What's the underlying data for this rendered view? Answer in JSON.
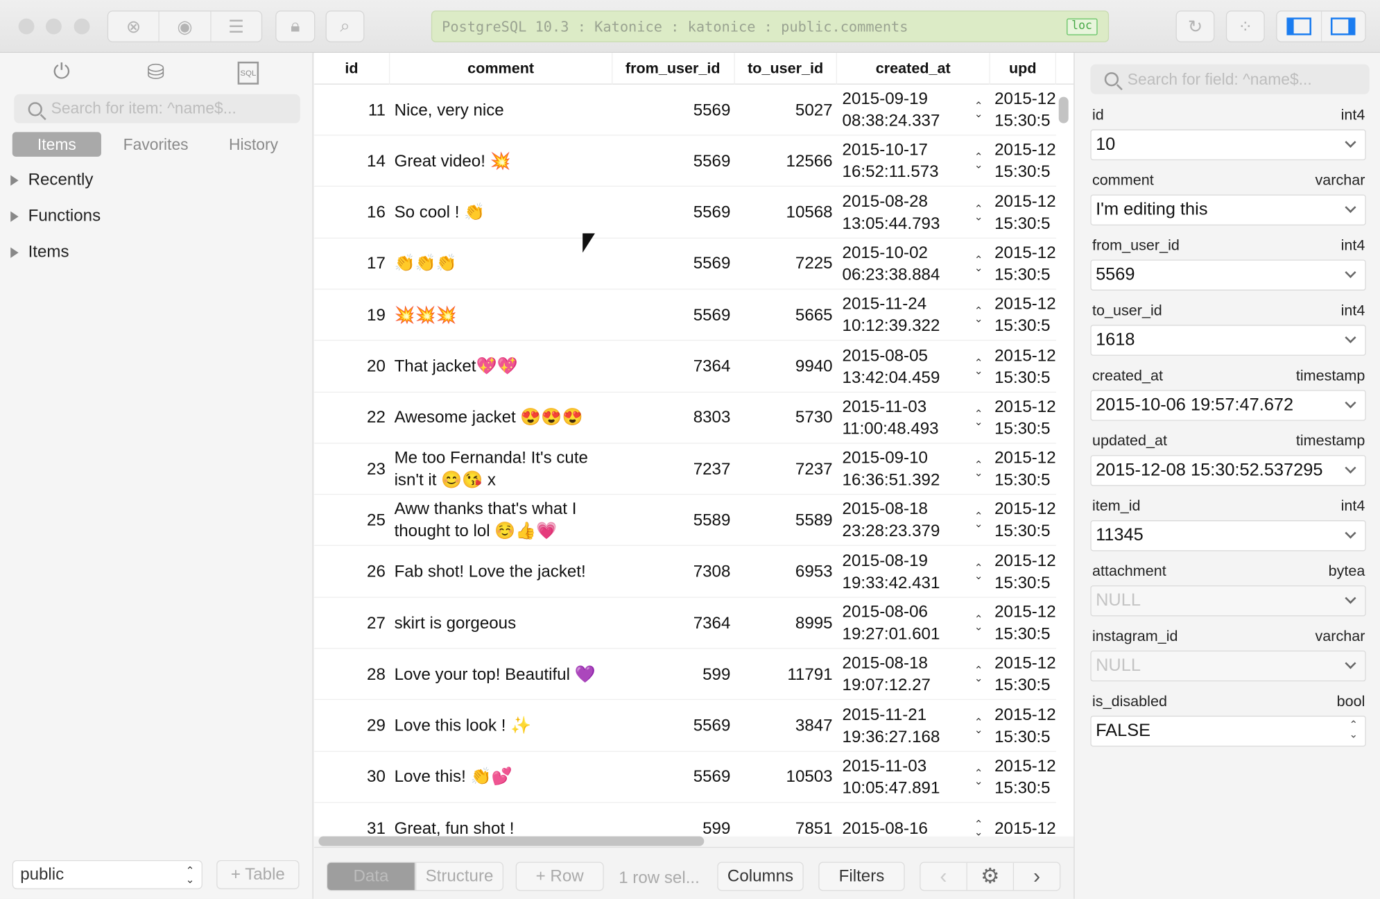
{
  "titlebar": {
    "address": "PostgreSQL 10.3 : Katonice : katonice : public.comments",
    "badge": "loc"
  },
  "sidebar": {
    "search_placeholder": "Search for item: ^name$...",
    "tabs": [
      "Items",
      "Favorites",
      "History"
    ],
    "selected_tab": "Items",
    "tree": [
      "Recently",
      "Functions",
      "Items"
    ],
    "schema": "public",
    "add_table": "+ Table",
    "icons": [
      "plug-icon",
      "database-icon",
      "sql-icon"
    ]
  },
  "grid": {
    "columns": [
      "id",
      "comment",
      "from_user_id",
      "to_user_id",
      "created_at",
      "upd"
    ],
    "rows": [
      [
        "11",
        "Nice, very nice",
        "5569",
        "5027",
        "2015-09-19",
        "08:38:24.337"
      ],
      [
        "14",
        "Great video! 💥",
        "5569",
        "12566",
        "2015-10-17",
        "16:52:11.573"
      ],
      [
        "16",
        "So cool ! 👏",
        "5569",
        "10568",
        "2015-08-28",
        "13:05:44.793"
      ],
      [
        "17",
        "👏👏👏",
        "5569",
        "7225",
        "2015-10-02",
        "06:23:38.884"
      ],
      [
        "19",
        "💥💥💥",
        "5569",
        "5665",
        "2015-11-24",
        "10:12:39.322"
      ],
      [
        "20",
        "That jacket💖💖",
        "7364",
        "9940",
        "2015-08-05",
        "13:42:04.459"
      ],
      [
        "22",
        "Awesome jacket 😍😍😍",
        "8303",
        "5730",
        "2015-11-03",
        "11:00:48.493"
      ],
      [
        "23",
        "Me too Fernanda! It's cute isn't it 😊😘 x",
        "7237",
        "7237",
        "2015-09-10",
        "16:36:51.392"
      ],
      [
        "25",
        "Aww thanks that's what I thought to lol ☺️👍💗",
        "5589",
        "5589",
        "2015-08-18",
        "23:28:23.379"
      ],
      [
        "26",
        "Fab shot! Love the jacket!",
        "7308",
        "6953",
        "2015-08-19",
        "19:33:42.431"
      ],
      [
        "27",
        "skirt is gorgeous",
        "7364",
        "8995",
        "2015-08-06",
        "19:27:01.601"
      ],
      [
        "28",
        "Love your top! Beautiful 💜",
        "599",
        "11791",
        "2015-08-18",
        "19:07:12.27"
      ],
      [
        "29",
        "Love this look ! ✨",
        "5569",
        "3847",
        "2015-11-21",
        "19:36:27.168"
      ],
      [
        "30",
        "Love this! 👏💕",
        "5569",
        "10503",
        "2015-11-03",
        "10:05:47.891"
      ],
      [
        "31",
        "Great, fun shot !",
        "599",
        "7851",
        "2015-08-16",
        ""
      ]
    ],
    "upd_date": "2015-12",
    "upd_time": "15:30:5"
  },
  "bottombar": {
    "data": "Data",
    "structure": "Structure",
    "add_row": "+ Row",
    "selection": "1 row sel...",
    "columns": "Columns",
    "filters": "Filters"
  },
  "panel": {
    "search_placeholder": "Search for field: ^name$...",
    "fields": [
      {
        "name": "id",
        "type": "int4",
        "value": "10",
        "null": false
      },
      {
        "name": "comment",
        "type": "varchar",
        "value": "I'm editing this",
        "null": false
      },
      {
        "name": "from_user_id",
        "type": "int4",
        "value": "5569",
        "null": false
      },
      {
        "name": "to_user_id",
        "type": "int4",
        "value": "1618",
        "null": false
      },
      {
        "name": "created_at",
        "type": "timestamp",
        "value": "2015-10-06 19:57:47.672",
        "null": false
      },
      {
        "name": "updated_at",
        "type": "timestamp",
        "value": "2015-12-08 15:30:52.537295",
        "null": false
      },
      {
        "name": "item_id",
        "type": "int4",
        "value": "11345",
        "null": false
      },
      {
        "name": "attachment",
        "type": "bytea",
        "value": "NULL",
        "null": true
      },
      {
        "name": "instagram_id",
        "type": "varchar",
        "value": "NULL",
        "null": true
      },
      {
        "name": "is_disabled",
        "type": "bool",
        "value": "FALSE",
        "null": false,
        "select": true
      }
    ]
  },
  "colors": {
    "address_bg": "#dcebc6",
    "badge": "#46a846",
    "toggle_active": "#1a7cf0",
    "selected_tab": "#a9a9a9"
  }
}
